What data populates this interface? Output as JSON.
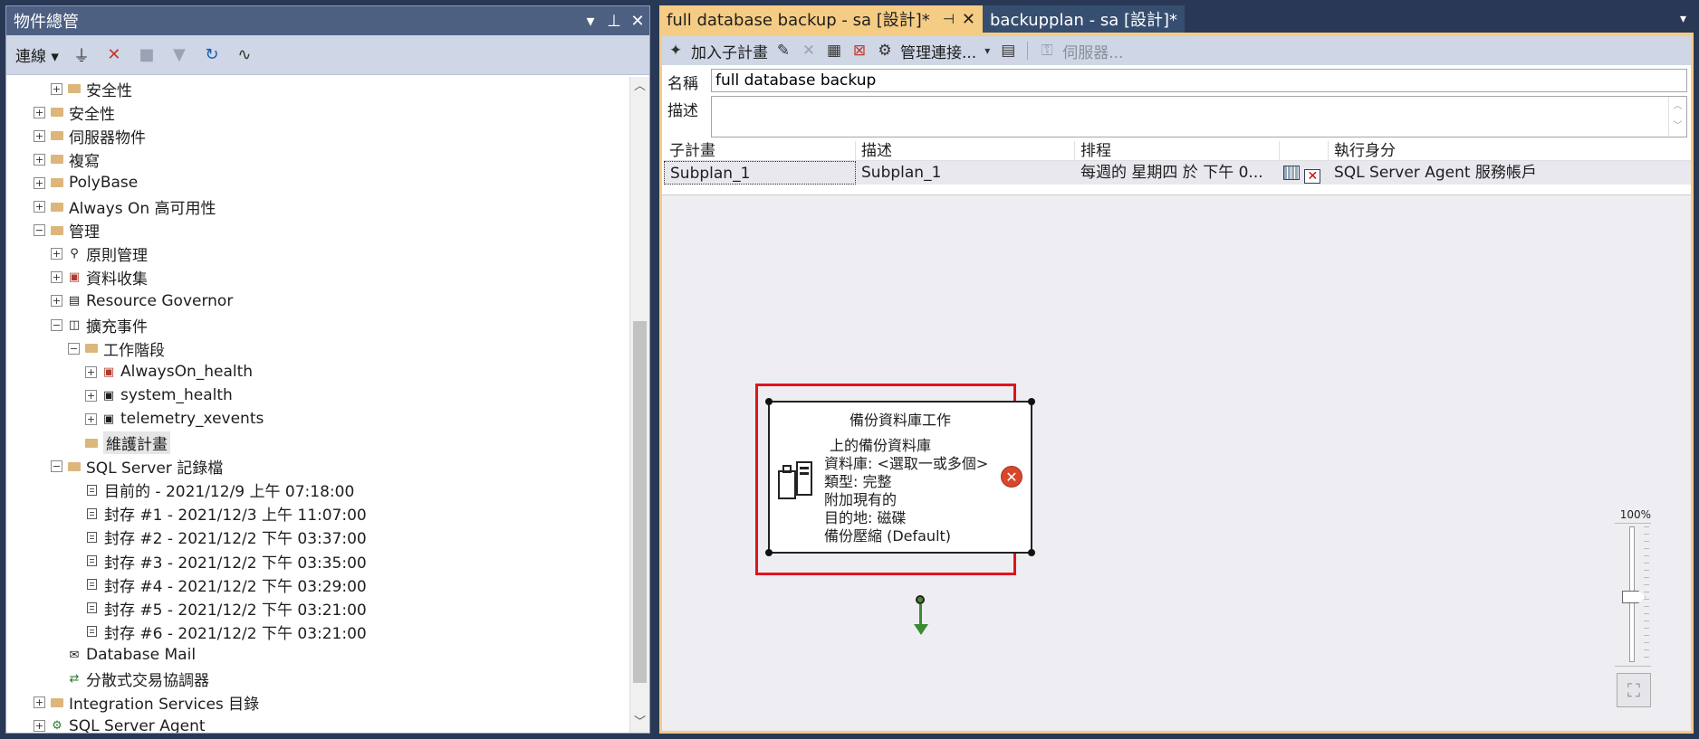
{
  "object_explorer": {
    "title": "物件總管",
    "toolbar": {
      "connect_label": "連線 ▾"
    },
    "tree": [
      {
        "label": "安全性",
        "indent": 3,
        "exp": "+",
        "icon": "folder"
      },
      {
        "label": "安全性",
        "indent": 2,
        "exp": "+",
        "icon": "folder"
      },
      {
        "label": "伺服器物件",
        "indent": 2,
        "exp": "+",
        "icon": "folder"
      },
      {
        "label": "複寫",
        "indent": 2,
        "exp": "+",
        "icon": "folder"
      },
      {
        "label": "PolyBase",
        "indent": 2,
        "exp": "+",
        "icon": "folder"
      },
      {
        "label": "Always On 高可用性",
        "indent": 2,
        "exp": "+",
        "icon": "folder"
      },
      {
        "label": "管理",
        "indent": 2,
        "exp": "−",
        "icon": "folder"
      },
      {
        "label": "原則管理",
        "indent": 3,
        "exp": "+",
        "icon": "policy"
      },
      {
        "label": "資料收集",
        "indent": 3,
        "exp": "+",
        "icon": "datacollect"
      },
      {
        "label": "Resource Governor",
        "indent": 3,
        "exp": "+",
        "icon": "governor"
      },
      {
        "label": "擴充事件",
        "indent": 3,
        "exp": "−",
        "icon": "xevent"
      },
      {
        "label": "工作階段",
        "indent": 4,
        "exp": "−",
        "icon": "folder"
      },
      {
        "label": "AlwaysOn_health",
        "indent": 5,
        "exp": "+",
        "icon": "session-red"
      },
      {
        "label": "system_health",
        "indent": 5,
        "exp": "+",
        "icon": "session"
      },
      {
        "label": "telemetry_xevents",
        "indent": 5,
        "exp": "+",
        "icon": "session"
      },
      {
        "label": "維護計畫",
        "indent": 4,
        "exp": "",
        "icon": "folder",
        "selected": true
      },
      {
        "label": "SQL Server 記錄檔",
        "indent": 3,
        "exp": "−",
        "icon": "folder"
      },
      {
        "label": "目前的 - 2021/12/9 上午 07:18:00",
        "indent": 4,
        "exp": "",
        "icon": "doc"
      },
      {
        "label": "封存 #1 - 2021/12/3 上午 11:07:00",
        "indent": 4,
        "exp": "",
        "icon": "doc"
      },
      {
        "label": "封存 #2 - 2021/12/2 下午 03:37:00",
        "indent": 4,
        "exp": "",
        "icon": "doc"
      },
      {
        "label": "封存 #3 - 2021/12/2 下午 03:35:00",
        "indent": 4,
        "exp": "",
        "icon": "doc"
      },
      {
        "label": "封存 #4 - 2021/12/2 下午 03:29:00",
        "indent": 4,
        "exp": "",
        "icon": "doc"
      },
      {
        "label": "封存 #5 - 2021/12/2 下午 03:21:00",
        "indent": 4,
        "exp": "",
        "icon": "doc"
      },
      {
        "label": "封存 #6 - 2021/12/2 下午 03:21:00",
        "indent": 4,
        "exp": "",
        "icon": "doc"
      },
      {
        "label": "Database Mail",
        "indent": 3,
        "exp": "",
        "icon": "mail"
      },
      {
        "label": "分散式交易協調器",
        "indent": 3,
        "exp": "",
        "icon": "dtc"
      },
      {
        "label": "Integration Services 目錄",
        "indent": 2,
        "exp": "+",
        "icon": "folder"
      },
      {
        "label": "SQL Server Agent",
        "indent": 2,
        "exp": "+",
        "icon": "agent"
      }
    ]
  },
  "tabs": {
    "active": {
      "label": "full database backup - sa [設計]*"
    },
    "inactive": {
      "label": "backupplan - sa [設計]*"
    }
  },
  "designer": {
    "toolbar": {
      "add_subplan": "加入子計畫",
      "manage_connections": "管理連接...",
      "servers": "伺服器..."
    },
    "name_label": "名稱",
    "name_value": "full database backup",
    "desc_label": "描述",
    "grid": {
      "headers": [
        "子計畫",
        "描述",
        "排程",
        "",
        "執行身分"
      ],
      "rows": [
        {
          "subplan": "Subplan_1",
          "desc": "Subplan_1",
          "schedule": "每週的 星期四 於 下午 0...",
          "run_as": "SQL Server Agent 服務帳戶"
        }
      ]
    },
    "task": {
      "title": "備份資料庫工作",
      "lines": [
        "上的備份資料庫",
        "資料庫: <選取一或多個>",
        "類型: 完整",
        "附加現有的",
        "目的地: 磁碟",
        "備份壓縮 (Default)"
      ]
    },
    "zoom_level": "100%"
  },
  "colors": {
    "tab_active": "#f5cc84",
    "frame": "#293955",
    "highlight": "#e0141e"
  }
}
